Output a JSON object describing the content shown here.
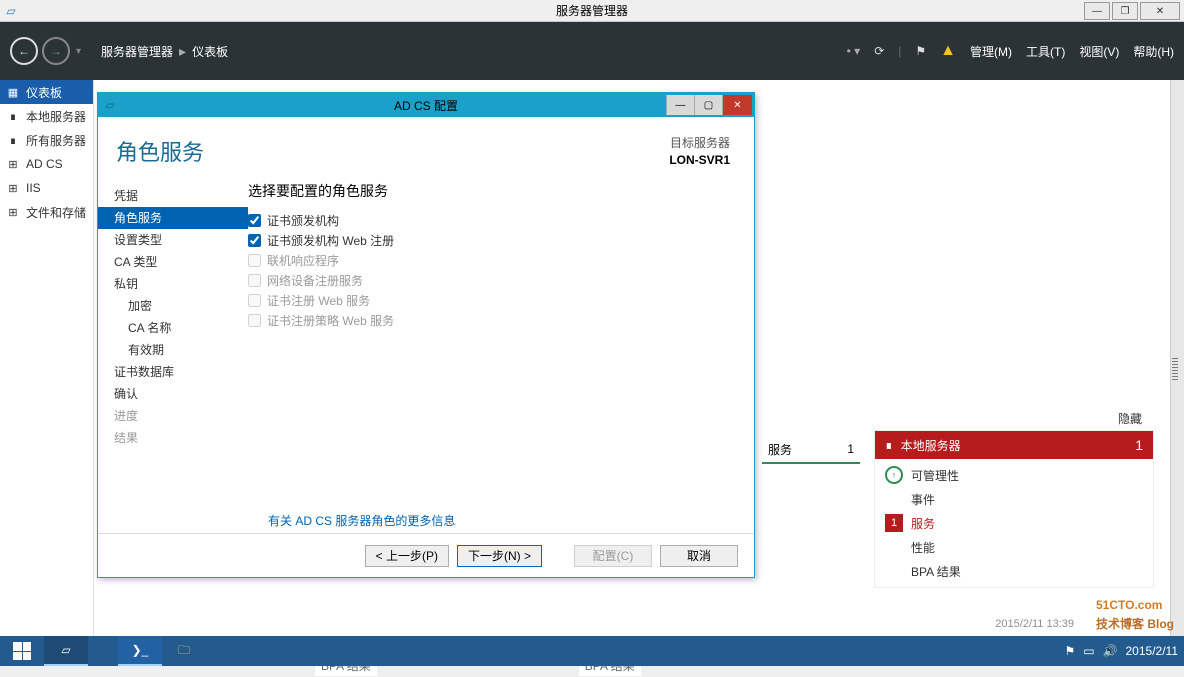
{
  "window": {
    "title": "服务器管理器",
    "min": "—",
    "max": "❐",
    "close": "✕"
  },
  "header": {
    "breadcrumb_root": "服务器管理器",
    "breadcrumb_page": "仪表板",
    "menu_manage": "管理(M)",
    "menu_tools": "工具(T)",
    "menu_view": "视图(V)",
    "menu_help": "帮助(H)"
  },
  "sidebar": {
    "items": [
      {
        "icon": "▦",
        "label": "仪表板"
      },
      {
        "icon": "∎",
        "label": "本地服务器"
      },
      {
        "icon": "∎",
        "label": "所有服务器"
      },
      {
        "icon": "⊞",
        "label": "AD CS"
      },
      {
        "icon": "⊞",
        "label": "IIS"
      },
      {
        "icon": "⊞",
        "label": "文件和存储"
      }
    ]
  },
  "main": {
    "hide_label": "隐藏",
    "bpa_text": "BPA 结果",
    "tile_left_label": "服务",
    "tile_left_count": "1",
    "tile_local": {
      "title": "本地服务器",
      "count": "1",
      "lines": [
        "可管理性",
        "事件",
        "服务",
        "性能",
        "BPA 结果"
      ],
      "alert_num": "1"
    },
    "timestamp_ghost": "2015/2/11 13:39"
  },
  "wizard": {
    "title": "AD CS 配置",
    "h1": "角色服务",
    "target_label": "目标服务器",
    "target_name": "LON-SVR1",
    "steps": [
      {
        "label": "凭据",
        "sel": false,
        "sub": false
      },
      {
        "label": "角色服务",
        "sel": true,
        "sub": false
      },
      {
        "label": "设置类型",
        "sel": false,
        "sub": false
      },
      {
        "label": "CA 类型",
        "sel": false,
        "sub": false
      },
      {
        "label": "私钥",
        "sel": false,
        "sub": false
      },
      {
        "label": "加密",
        "sel": false,
        "sub": true
      },
      {
        "label": "CA 名称",
        "sel": false,
        "sub": true
      },
      {
        "label": "有效期",
        "sel": false,
        "sub": true
      },
      {
        "label": "证书数据库",
        "sel": false,
        "sub": false
      },
      {
        "label": "确认",
        "sel": false,
        "sub": false
      },
      {
        "label": "进度",
        "sel": false,
        "sub": false,
        "dis": true
      },
      {
        "label": "结果",
        "sel": false,
        "sub": false,
        "dis": true
      }
    ],
    "subtitle": "选择要配置的角色服务",
    "options": [
      {
        "label": "证书颁发机构",
        "checked": true,
        "disabled": false
      },
      {
        "label": "证书颁发机构 Web 注册",
        "checked": true,
        "disabled": false
      },
      {
        "label": "联机响应程序",
        "checked": false,
        "disabled": true
      },
      {
        "label": "网络设备注册服务",
        "checked": false,
        "disabled": true
      },
      {
        "label": "证书注册 Web 服务",
        "checked": false,
        "disabled": true
      },
      {
        "label": "证书注册策略 Web 服务",
        "checked": false,
        "disabled": true
      }
    ],
    "more_link": "有关 AD CS 服务器角色的更多信息",
    "btn_prev": "< 上一步(P)",
    "btn_next": "下一步(N) >",
    "btn_cfg": "配置(C)",
    "btn_cancel": "取消"
  },
  "taskbar": {
    "date": "2015/2/11"
  },
  "watermark": {
    "main": "51CTO.com",
    "sub": "技术博客  Blog"
  }
}
